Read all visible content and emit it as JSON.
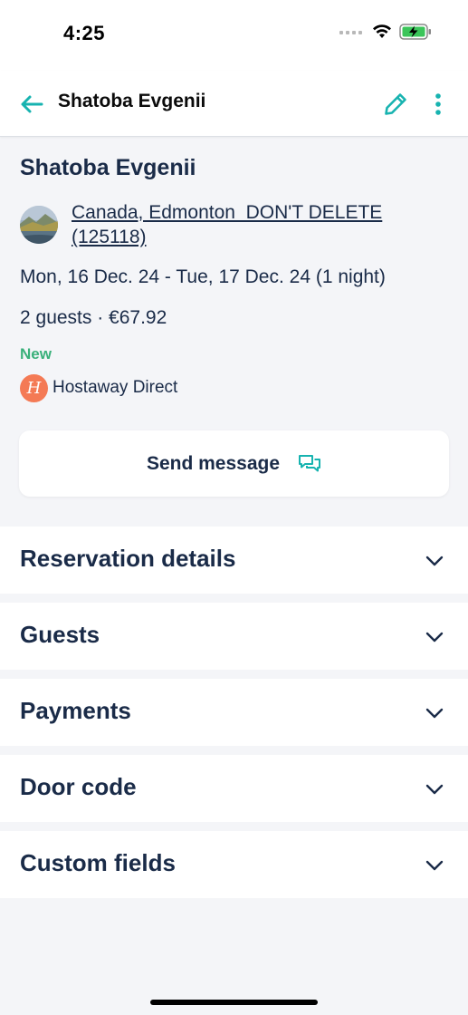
{
  "status_bar": {
    "time": "4:25"
  },
  "header": {
    "title": "Shatoba Evgenii",
    "back_icon": "arrow-left-icon",
    "edit_icon": "pencil-icon",
    "more_icon": "more-vertical-icon"
  },
  "reservation": {
    "guest_name": "Shatoba Evgenii",
    "listing": "Canada, Edmonton_DON'T DELETE (125118)",
    "dates": "Mon, 16 Dec. 24 - Tue, 17 Dec. 24 (1 night)",
    "guests_price": "2 guests · €67.92",
    "status": "New",
    "channel": {
      "initial": "H",
      "label": "Hostaway Direct"
    }
  },
  "send_message": {
    "label": "Send message",
    "icon": "chat-bubbles-icon"
  },
  "sections": [
    {
      "title": "Reservation details"
    },
    {
      "title": "Guests"
    },
    {
      "title": "Payments"
    },
    {
      "title": "Door code"
    },
    {
      "title": "Custom fields"
    }
  ],
  "colors": {
    "accent": "#17b3b0",
    "status_new": "#39b07a",
    "channel_badge": "#f47a55",
    "text_primary": "#1a2b48",
    "background": "#f4f5f8"
  }
}
